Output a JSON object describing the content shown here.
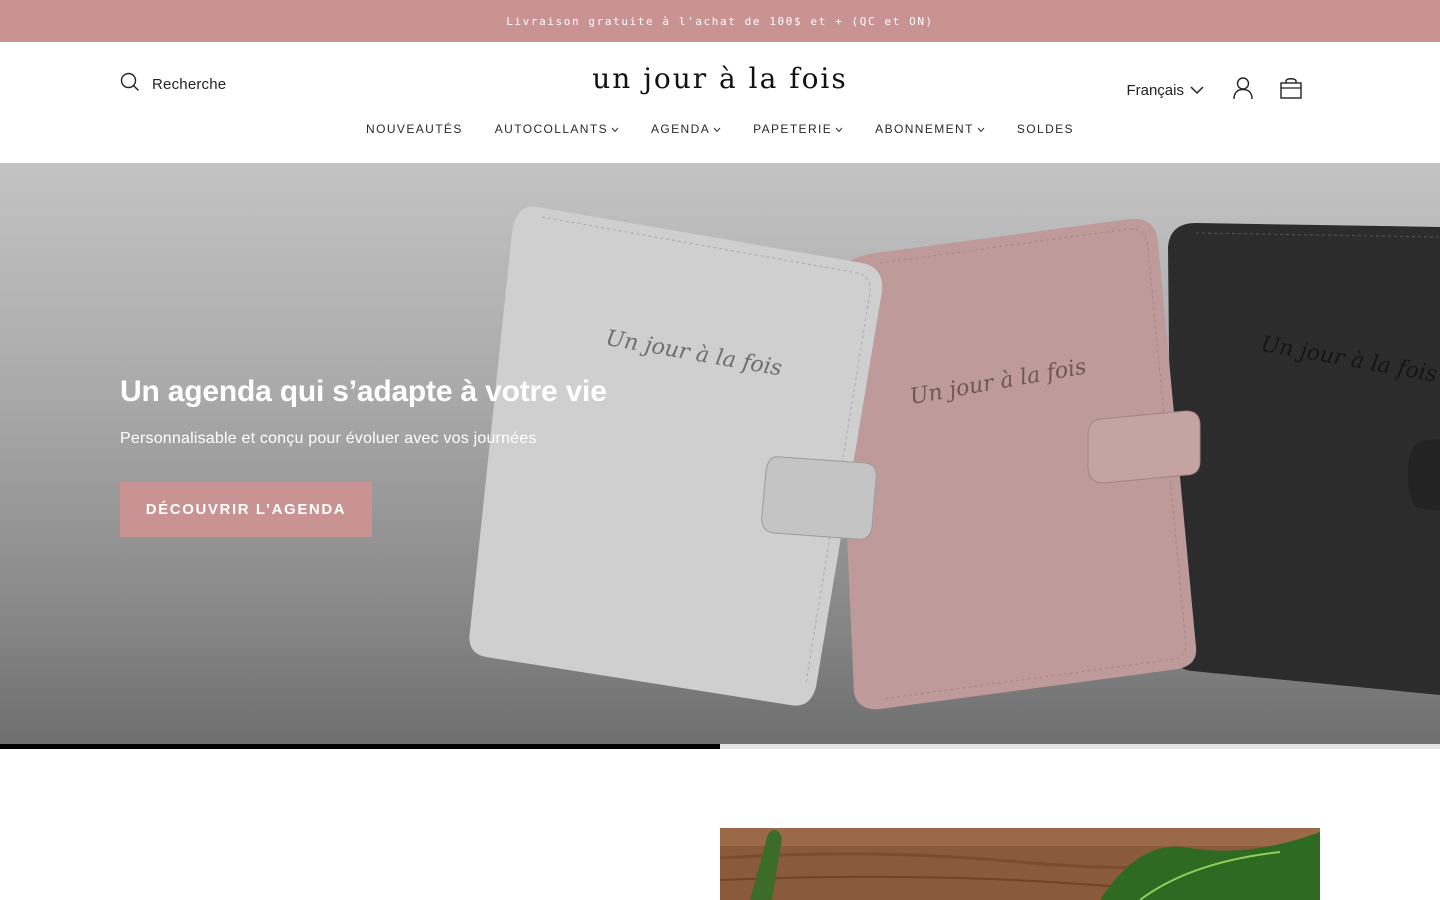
{
  "announcement": {
    "text": "Livraison gratuite à l'achat de 100$ et + (QC et ON)"
  },
  "header": {
    "search_label": "Recherche",
    "logo_text": "un jour à la fois",
    "language": "Français",
    "icons": {
      "search": "search-icon",
      "account": "user-icon",
      "cart": "shopping-bag-icon",
      "language_caret": "chevron-down-icon"
    }
  },
  "nav": {
    "items": [
      {
        "label": "NOUVEAUTÉS",
        "has_dropdown": false
      },
      {
        "label": "AUTOCOLLANTS",
        "has_dropdown": true
      },
      {
        "label": "AGENDA",
        "has_dropdown": true
      },
      {
        "label": "PAPETERIE",
        "has_dropdown": true
      },
      {
        "label": "ABONNEMENT",
        "has_dropdown": true
      },
      {
        "label": "SOLDES",
        "has_dropdown": false
      }
    ]
  },
  "hero": {
    "title": "Un agenda qui s’adapte à votre vie",
    "subtitle": "Personnalisable et conçu pour évoluer avec vos journées",
    "cta_label": "DÉCOUVRIR L’AGENDA",
    "cover_script": "Un jour à la fois",
    "slide_progress": 0.5
  },
  "colors": {
    "brand_pink": "#c99394",
    "cover_grey": "#cfcfcf",
    "cover_pink": "#bf9a9a",
    "cover_black": "#2c2c2c",
    "text_dark": "#1f1f1f"
  }
}
